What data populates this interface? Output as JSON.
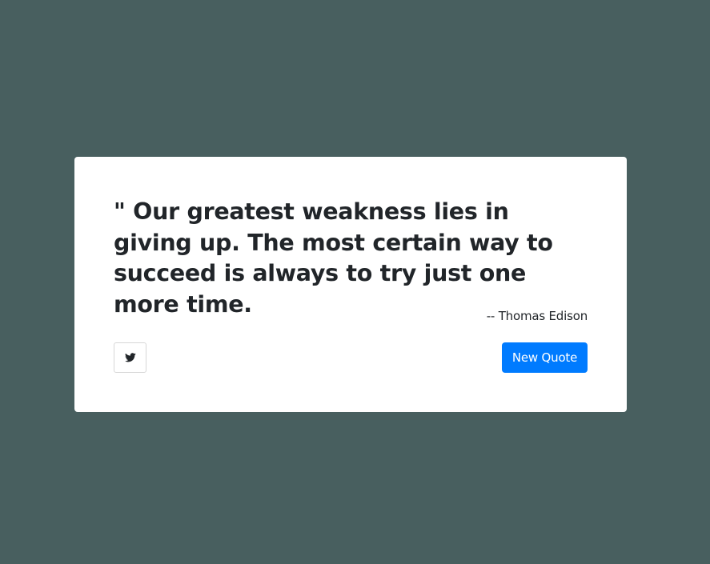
{
  "quote": {
    "text": "\" Our greatest weakness lies in giving up. The most certain way to succeed is always to try just one more time.",
    "author": "-- Thomas Edison"
  },
  "actions": {
    "tweet_icon": "twitter-icon",
    "new_quote_label": "New Quote"
  },
  "colors": {
    "page_background": "#485f5f",
    "card_background": "#ffffff",
    "text": "#212529",
    "button_primary": "#007bff"
  }
}
